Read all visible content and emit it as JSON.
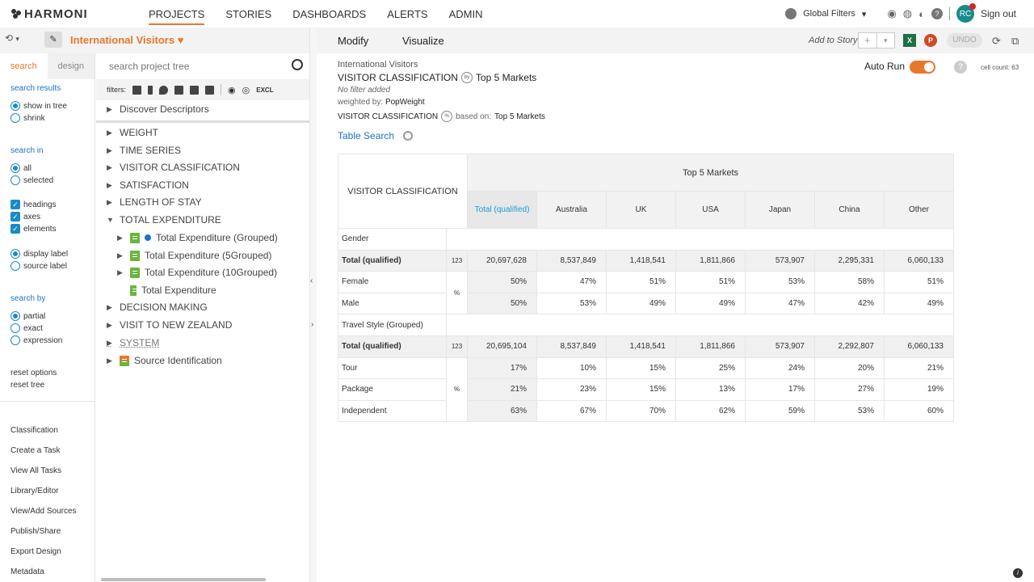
{
  "app": {
    "brand": "HARMONI"
  },
  "nav": {
    "items": [
      "PROJECTS",
      "STORIES",
      "DASHBOARDS",
      "ALERTS",
      "ADMIN"
    ],
    "active": "PROJECTS"
  },
  "topright": {
    "global_filters": "Global Filters",
    "avatar": "RC",
    "signout": "Sign out"
  },
  "project": {
    "title": "International Visitors"
  },
  "toolbar": {
    "modify": "Modify",
    "visualize": "Visualize",
    "add_story": "Add to Story",
    "undo": "UNDO",
    "xl": "X",
    "ppt": "P"
  },
  "leftnav": {
    "tabs": [
      "search",
      "design"
    ],
    "search_results": "search results",
    "show_in_tree": "show in tree",
    "shrink": "shrink",
    "search_in": "search in",
    "all": "all",
    "selected": "selected",
    "headings": "headings",
    "axes": "axes",
    "elements": "elements",
    "display_label": "display label",
    "source_label": "source label",
    "search_by": "search by",
    "partial": "partial",
    "exact": "exact",
    "expression": "expression",
    "reset_options": "reset options",
    "reset_tree": "reset tree",
    "links": [
      "Classification",
      "Create a Task",
      "View All Tasks",
      "Library/Editor",
      "View/Add Sources",
      "Publish/Share",
      "Export Design",
      "Metadata"
    ]
  },
  "tree": {
    "search_placeholder": "search project tree",
    "filters_label": "filters:",
    "excl": "EXCL",
    "nodes": [
      {
        "label": "Discover Descriptors"
      },
      {
        "label": "WEIGHT"
      },
      {
        "label": "TIME SERIES"
      },
      {
        "label": "VISITOR CLASSIFICATION"
      },
      {
        "label": "SATISFACTION"
      },
      {
        "label": "LENGTH OF STAY"
      },
      {
        "label": "TOTAL EXPENDITURE"
      },
      {
        "label": "Total Expenditure (Grouped)"
      },
      {
        "label": "Total Expenditure (5Grouped)"
      },
      {
        "label": "Total Expenditure (10Grouped)"
      },
      {
        "label": "Total Expenditure"
      },
      {
        "label": "DECISION MAKING"
      },
      {
        "label": "VISIT TO NEW ZEALAND"
      },
      {
        "label": "SYSTEM"
      },
      {
        "label": "Source Identification"
      }
    ]
  },
  "report": {
    "project": "International Visitors",
    "row_var": "VISITOR CLASSIFICATION",
    "by": "by",
    "col_var": "Top 5 Markets",
    "no_filter": "No filter added",
    "weighted_label": "weighted by:",
    "weight": "PopWeight",
    "based_on_label": "based on:",
    "pct": "%",
    "table_search": "Table Search",
    "auto_run": "Auto Run",
    "cell_count": "cell count: 63"
  },
  "table": {
    "corner": "VISITOR CLASSIFICATION",
    "banner": "Top 5 Markets",
    "columns": [
      "Total (qualified)",
      "Australia",
      "UK",
      "USA",
      "Japan",
      "China",
      "Other"
    ],
    "sections": [
      {
        "title": "Gender",
        "total_label": "Total (qualified)",
        "total_stat": "123",
        "totals": [
          "20,697,628",
          "8,537,849",
          "1,418,541",
          "1,811,866",
          "573,907",
          "2,295,331",
          "6,060,133"
        ],
        "pct_stat": "%",
        "rows": [
          {
            "label": "Female",
            "values": [
              "50%",
              "47%",
              "51%",
              "51%",
              "53%",
              "58%",
              "51%"
            ]
          },
          {
            "label": "Male",
            "values": [
              "50%",
              "53%",
              "49%",
              "49%",
              "47%",
              "42%",
              "49%"
            ]
          }
        ]
      },
      {
        "title": "Travel Style (Grouped)",
        "total_label": "Total (qualified)",
        "total_stat": "123",
        "totals": [
          "20,695,104",
          "8,537,849",
          "1,418,541",
          "1,811,866",
          "573,907",
          "2,292,807",
          "6,060,133"
        ],
        "pct_stat": "%",
        "rows": [
          {
            "label": "Tour",
            "values": [
              "17%",
              "10%",
              "15%",
              "25%",
              "24%",
              "20%",
              "21%"
            ]
          },
          {
            "label": "Package",
            "values": [
              "21%",
              "23%",
              "15%",
              "13%",
              "17%",
              "27%",
              "19%"
            ]
          },
          {
            "label": "Independent",
            "values": [
              "63%",
              "67%",
              "70%",
              "62%",
              "59%",
              "53%",
              "60%"
            ]
          }
        ]
      }
    ]
  }
}
